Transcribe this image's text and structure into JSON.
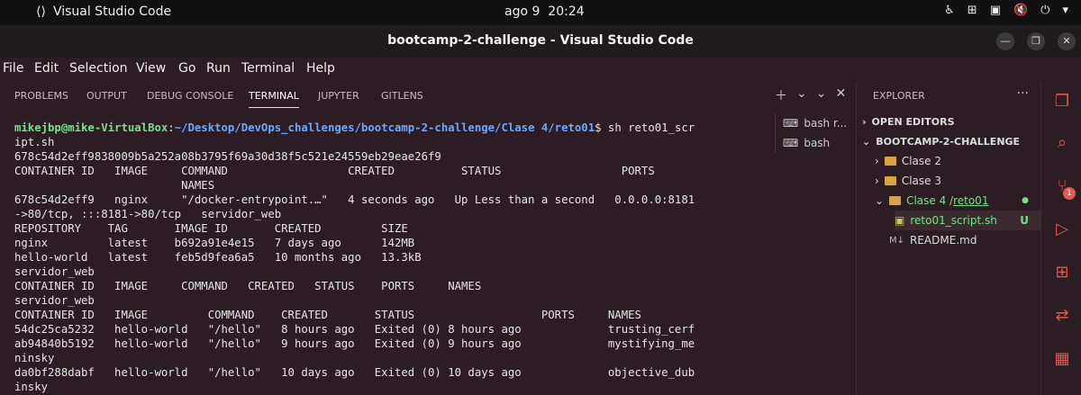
{
  "topbar": {
    "app_name": "Visual Studio Code",
    "date": "ago 9",
    "time": "20:24"
  },
  "titlebar": {
    "title": "bootcamp-2-challenge - Visual Studio Code"
  },
  "menu": [
    "File",
    "Edit",
    "Selection",
    "View",
    "Go",
    "Run",
    "Terminal",
    "Help"
  ],
  "panel_tabs": [
    "PROBLEMS",
    "OUTPUT",
    "DEBUG CONSOLE",
    "TERMINAL",
    "JUPYTER",
    "GITLENS"
  ],
  "terminal": {
    "prompt_user": "mikejbp@mike-VirtualBox",
    "prompt_path": "~/Desktop/DevOps_challenges/bootcamp-2-challenge/Clase 4/reto01",
    "command": "$ sh reto01_scr",
    "lines": [
      "ipt.sh",
      "678c54d2eff9838009b5a252a08b3795f69a30d38f5c521e24559eb29eae26f9",
      "CONTAINER ID   IMAGE     COMMAND                  CREATED          STATUS                  PORTS",
      "                         NAMES",
      "678c54d2eff9   nginx     \"/docker-entrypoint.…\"   4 seconds ago   Up Less than a second   0.0.0.0:8181",
      "->80/tcp, :::8181->80/tcp   servidor_web",
      "REPOSITORY    TAG       IMAGE ID       CREATED         SIZE",
      "nginx         latest    b692a91e4e15   7 days ago      142MB",
      "hello-world   latest    feb5d9fea6a5   10 months ago   13.3kB",
      "servidor_web",
      "CONTAINER ID   IMAGE     COMMAND   CREATED   STATUS    PORTS     NAMES",
      "servidor_web",
      "CONTAINER ID   IMAGE         COMMAND    CREATED       STATUS                   PORTS     NAMES",
      "54dc25ca5232   hello-world   \"/hello\"   8 hours ago   Exited (0) 8 hours ago             trusting_cerf",
      "ab94840b5192   hello-world   \"/hello\"   9 hours ago   Exited (0) 9 hours ago             mystifying_me",
      "ninsky",
      "da0bf288dabf   hello-world   \"/hello\"   10 days ago   Exited (0) 10 days ago             objective_dub",
      "insky"
    ],
    "sessions": [
      "bash  r...",
      "bash"
    ]
  },
  "explorer": {
    "header": "EXPLORER",
    "open_editors": "OPEN EDITORS",
    "workspace": "BOOTCAMP-2-CHALLENGE",
    "items": [
      {
        "label": "Clase 2"
      },
      {
        "label": "Clase 3"
      },
      {
        "label": "Clase 4 / ",
        "link": "reto01"
      },
      {
        "label": "reto01_script.sh",
        "badge": "U"
      },
      {
        "label": "README.md"
      }
    ]
  },
  "colors": {
    "accent": "#e05a4f",
    "terminal_bg": "#2b1d23",
    "git_green": "#78e08f"
  },
  "activity_badge": "1"
}
